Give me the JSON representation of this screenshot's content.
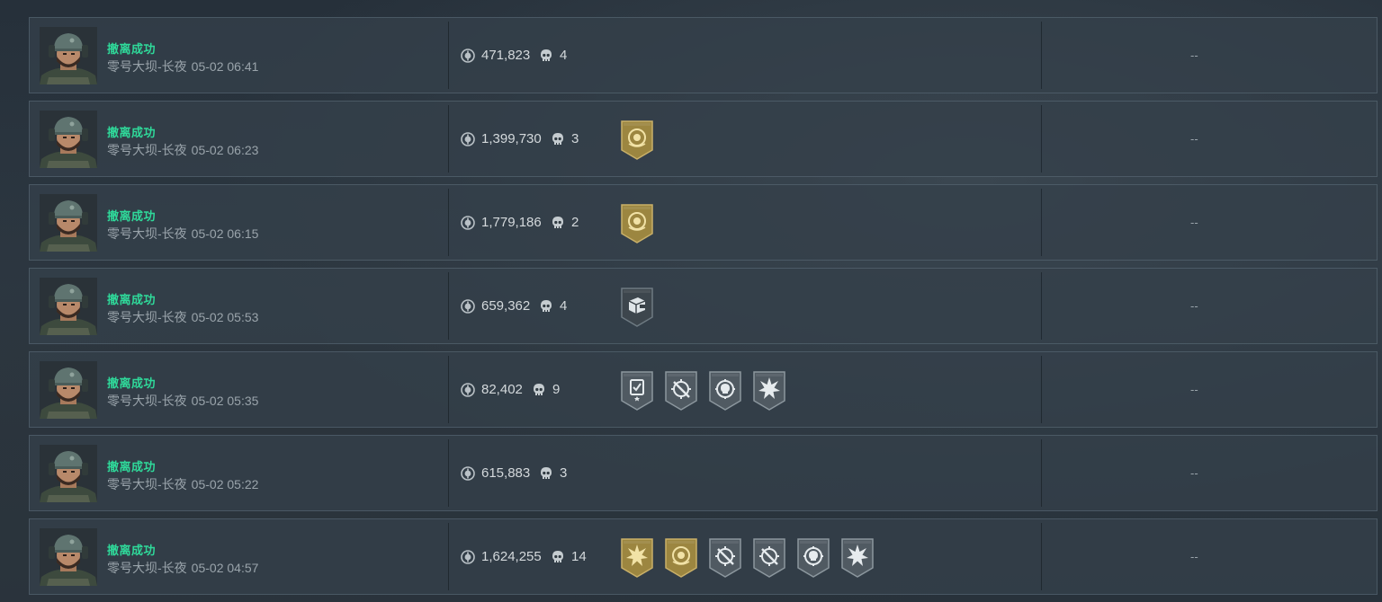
{
  "colors": {
    "status_green": "#2fd99a",
    "gold_badge": "#9c8640",
    "gray_badge": "#505a62"
  },
  "rows": [
    {
      "status": "撤离成功",
      "map": "零号大坝-长夜",
      "time": "05-02 06:41",
      "value": "471,823",
      "kills": "4",
      "badges": [],
      "extra": "--"
    },
    {
      "status": "撤离成功",
      "map": "零号大坝-长夜",
      "time": "05-02 06:23",
      "value": "1,399,730",
      "kills": "3",
      "badges": [
        {
          "style": "gold",
          "icon": "coin-emblem-icon"
        }
      ],
      "extra": "--"
    },
    {
      "status": "撤离成功",
      "map": "零号大坝-长夜",
      "time": "05-02 06:15",
      "value": "1,779,186",
      "kills": "2",
      "badges": [
        {
          "style": "gold",
          "icon": "coin-emblem-icon"
        }
      ],
      "extra": "--"
    },
    {
      "status": "撤离成功",
      "map": "零号大坝-长夜",
      "time": "05-02 05:53",
      "value": "659,362",
      "kills": "4",
      "badges": [
        {
          "style": "dark",
          "icon": "cargo-icon"
        }
      ],
      "extra": "--"
    },
    {
      "status": "撤离成功",
      "map": "零号大坝-长夜",
      "time": "05-02 05:35",
      "value": "82,402",
      "kills": "9",
      "badges": [
        {
          "style": "gray",
          "icon": "clipboard-star-icon"
        },
        {
          "style": "gray",
          "icon": "crosshair-slash-icon"
        },
        {
          "style": "gray",
          "icon": "skull-target-icon"
        },
        {
          "style": "gray",
          "icon": "burst-icon"
        }
      ],
      "extra": "--"
    },
    {
      "status": "撤离成功",
      "map": "零号大坝-长夜",
      "time": "05-02 05:22",
      "value": "615,883",
      "kills": "3",
      "badges": [],
      "extra": "--"
    },
    {
      "status": "撤离成功",
      "map": "零号大坝-长夜",
      "time": "05-02 04:57",
      "value": "1,624,255",
      "kills": "14",
      "badges": [
        {
          "style": "gold",
          "icon": "burst-icon"
        },
        {
          "style": "gold",
          "icon": "coin-emblem-icon"
        },
        {
          "style": "gray",
          "icon": "crosshair-slash-icon"
        },
        {
          "style": "gray",
          "icon": "crosshair-slash-icon"
        },
        {
          "style": "gray",
          "icon": "skull-target-icon"
        },
        {
          "style": "gray",
          "icon": "burst-icon"
        }
      ],
      "extra": "--"
    }
  ]
}
